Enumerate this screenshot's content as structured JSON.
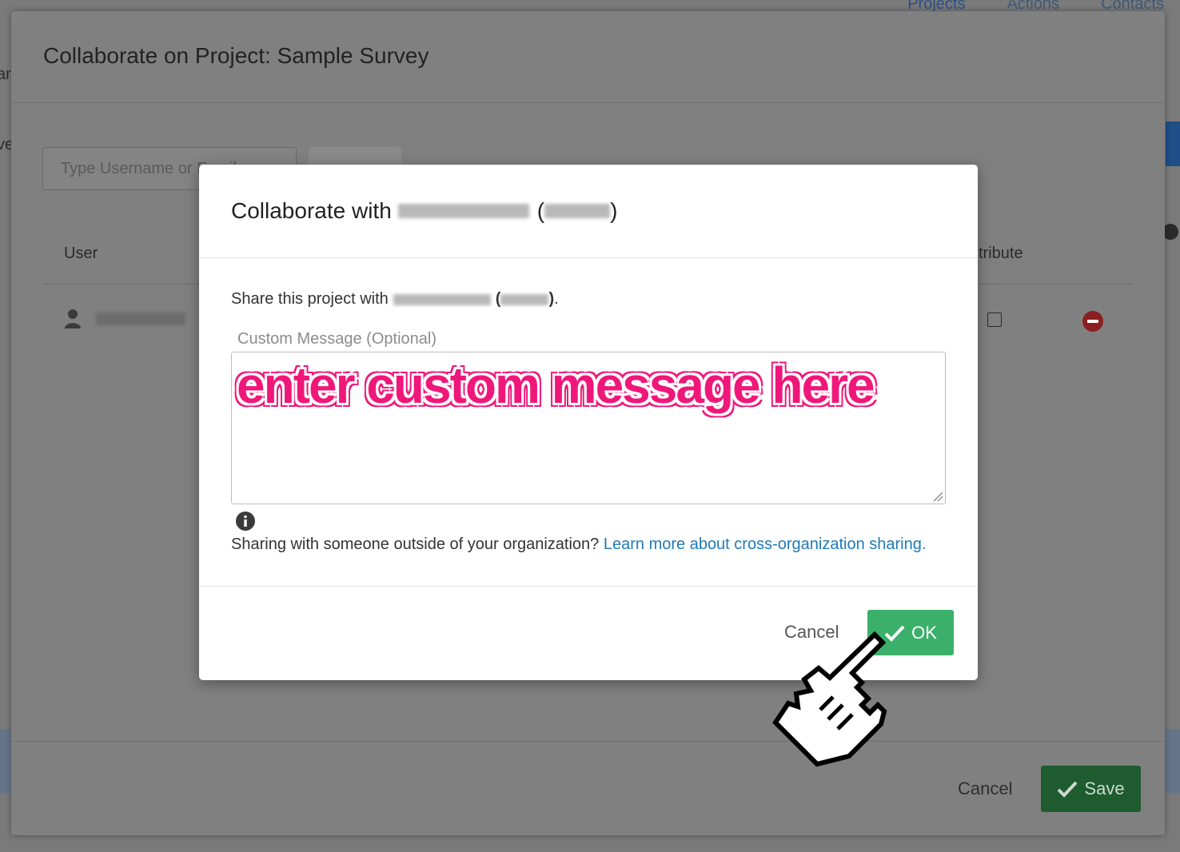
{
  "background": {
    "top_nav": [
      "Projects",
      "Actions",
      "Contacts"
    ],
    "left_edge_fragments": [
      "an",
      "ve"
    ]
  },
  "outer_dialog": {
    "title": "Collaborate on Project: Sample Survey",
    "search_placeholder": "Type Username or Email...",
    "columns": {
      "user": "User",
      "distribute": "stribute"
    },
    "cancel_label": "Cancel",
    "save_label": "Save"
  },
  "modal": {
    "title_prefix": "Collaborate with",
    "share_prefix": "Share this project with",
    "custom_message_label": "Custom Message (Optional)",
    "message_text": "enter custom message here",
    "sharing_note": "Sharing with someone outside of your organization?",
    "sharing_link": "Learn more about cross-organization sharing.",
    "cancel_label": "Cancel",
    "ok_label": "OK"
  },
  "colors": {
    "ok_green": "#3bb06a",
    "save_green": "#1e5c30",
    "link_blue": "#1f7ab8",
    "annotation_pink": "#f0177a",
    "remove_red": "#c0392b"
  },
  "icons": {
    "check": "check-icon",
    "info": "info-icon",
    "user": "user-icon",
    "remove": "remove-circle-icon",
    "pointer": "hand-pointer-icon"
  }
}
